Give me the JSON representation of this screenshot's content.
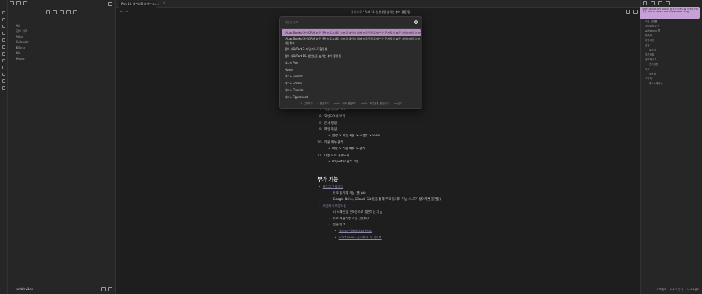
{
  "sidebar": {
    "tree": [
      {
        "chevron": "›",
        "label": ""
      },
      {
        "chevron": "›",
        "label": "All"
      },
      {
        "chevron": "›",
        "label": "강의 자료"
      },
      {
        "chevron": "›",
        "label": "Atlas"
      },
      {
        "chevron": "›",
        "label": "Calendar"
      },
      {
        "chevron": "›",
        "label": "Efforts"
      },
      {
        "chevron": "›",
        "label": "Kit"
      },
      {
        "chevron": "›",
        "label": "Home"
      }
    ],
    "vault_name": "tumblr-vibes"
  },
  "tabs": [
    {
      "label": "Part 10. 생산성을 높이는 추가 활동 팁"
    }
  ],
  "tab_close": "×",
  "tab_add": "+",
  "header": {
    "breadcrumb_parent": "강의 자료",
    "breadcrumb_sep": "/",
    "breadcrumb_current": "Part 10. 생산성을 높이는 추가 활동 팁",
    "back": "←",
    "forward": "→"
  },
  "modal": {
    "placeholder": "파일명 검색...",
    "close": "×",
    "items": [
      {
        "label": "(Atlas)Books/아이 ORM 표준 JPA 프로그래밍 스프링 데이터 예제 프로젝트로 배우는 전자정부 표준 데이터베이스 프레임워크",
        "selected": true
      },
      {
        "label": "(Atlas)Books/아이 ORM 표준 JPA 프로그래밍 스프링 데이터 예제 프로젝트로 배우는 전자정부 표준 데이터베이스 프레임워크"
      },
      {
        "label": "강의 자료/Part 3. 데일리노트 활용법"
      },
      {
        "label": "강의 자료/Part 10. 생산성을 높이는 추가 활용 팁"
      },
      {
        "label": "태그스 Fun"
      },
      {
        "label": "Home"
      },
      {
        "label": "태그스 Friends"
      },
      {
        "label": "태그스 Fitness"
      },
      {
        "label": "태그스 Finance"
      },
      {
        "label": "태그스 Figurehead"
      }
    ],
    "footer": [
      "↑↓ 선택하기",
      "↵ 열람하기",
      "cmd ↵ 새로 열람하기",
      "shift ↵ 화면분할 열람하기",
      "esc 닫기"
    ]
  },
  "content": {
    "ordered": [
      {
        "n": "7.",
        "text": "기본 캡체서 보기"
      },
      {
        "n": "8.",
        "text": "외인오에서 보기"
      },
      {
        "n": "9.",
        "text": "문서 병합"
      },
      {
        "n": "9.",
        "text": "파일 복원"
      },
      {
        "n": "10.",
        "text": "리본 메뉴 관리"
      },
      {
        "n": "11.",
        "text": "다른 노트 가져오기"
      }
    ],
    "sub1": "설정 > 파일 복원 > 스냅샷 > View",
    "sub2": "파봉 > 리본 메뉴 > 관리",
    "sub3": "Importer 플러그인",
    "heading": "부가 기능",
    "b1": "플러그인 로드샵",
    "b1a": "유료 동기화 기능 (월 $4)",
    "b1b": "Google Drive, iCloud, Git 등을 통해 무료 동기화 기능 (노트가 많아지면 불편함)",
    "b2": "퍼블리쉬 퍼블리싱",
    "b2a": "내 브레인을 온라인으로 출판하는 기능",
    "b2b": "유료 퍼블리싱 기능 (월 $8)",
    "b2c": "샘플 링크",
    "b2c1": "Home - Obsidian Help",
    "b2c2": "Start here - 공작재의 가 깃허브"
  },
  "right": {
    "notice": "Time to look (by Tap)의 링크가 자동으로 수정되었습니다. Log in, Open web (Open web. app)...",
    "outline": [
      {
        "label": "고급 장표를",
        "indent": 0
      },
      {
        "label": "코어플러그인",
        "indent": 0
      },
      {
        "label": "Advanced 탭",
        "indent": 0
      },
      {
        "label": "릴렉서",
        "indent": 0
      },
      {
        "label": "아웃라인",
        "indent": 0
      },
      {
        "label": "꿈영",
        "indent": 0
      },
      {
        "label": "글쓰기",
        "indent": 1
      },
      {
        "label": "작가의뷰",
        "indent": 0
      },
      {
        "label": "정리하시고",
        "indent": 0
      },
      {
        "label": "진리생활",
        "indent": 1
      },
      {
        "label": "작국",
        "indent": 0
      },
      {
        "label": "캘린더",
        "indent": 1
      },
      {
        "label": "고유의",
        "indent": 0
      },
      {
        "label": "워크스페이스",
        "indent": 1
      }
    ],
    "status": [
      "0 백링크",
      "1,329 단어",
      "3,484 글자"
    ]
  }
}
